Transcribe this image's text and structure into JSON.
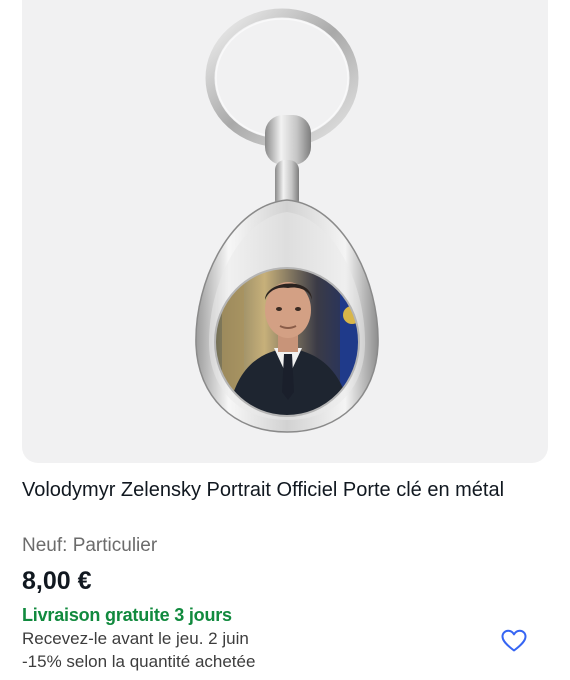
{
  "listing": {
    "title": "Volodymyr Zelensky Portrait Officiel Porte clé en métal",
    "condition": "Neuf: Particulier",
    "price": "8,00 €",
    "shipping": "Livraison gratuite 3 jours",
    "delivery_estimate": "Recevez-le avant le jeu. 2 juin",
    "discount": "-15% selon la quantité achetée"
  },
  "icons": {
    "watch": "heart-outline-icon"
  },
  "colors": {
    "shipping_green": "#118a3e",
    "watch_blue": "#3665f3",
    "image_bg": "#f1f1f2"
  }
}
